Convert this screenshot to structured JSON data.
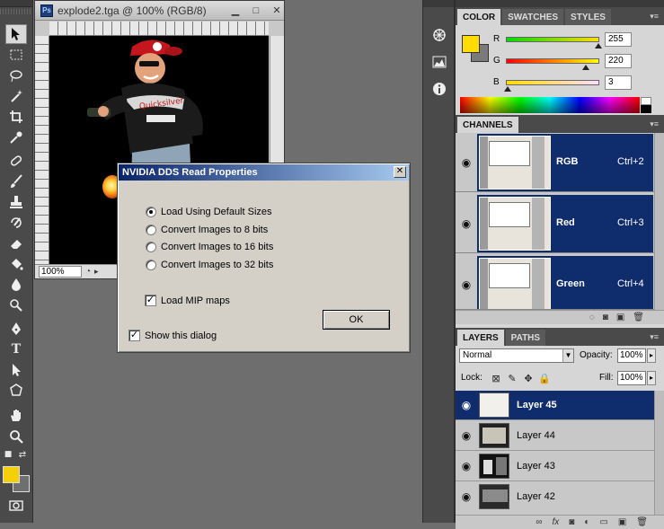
{
  "document": {
    "title": "explode2.tga @ 100% (RGB/8)",
    "ps_badge": "Ps",
    "zoom": "100%"
  },
  "dialog": {
    "title": "NVIDIA DDS Read Properties",
    "close": "✕",
    "options": [
      {
        "label": "Load Using Default Sizes",
        "selected": true
      },
      {
        "label": "Convert Images to 8 bits",
        "selected": false
      },
      {
        "label": "Convert Images to 16 bits",
        "selected": false
      },
      {
        "label": "Convert Images to 32 bits",
        "selected": false
      }
    ],
    "load_mip_maps": {
      "label": "Load MIP maps",
      "checked": true
    },
    "show_dialog": {
      "label": "Show this dialog",
      "checked": true
    },
    "ok_label": "OK"
  },
  "toolbox": {
    "foreground_color": "#f5cf0a",
    "background_color": "#6f6f6f"
  },
  "color_panel": {
    "tabs": [
      "COLOR",
      "SWATCHES",
      "STYLES"
    ],
    "sliders": [
      {
        "label": "R",
        "value": "255",
        "fraction": 1.0
      },
      {
        "label": "G",
        "value": "220",
        "fraction": 0.863
      },
      {
        "label": "B",
        "value": "3",
        "fraction": 0.012
      }
    ],
    "foreground_color": "#ffdc03"
  },
  "channels_panel": {
    "tabs": [
      "CHANNELS"
    ],
    "channels": [
      {
        "name": "RGB",
        "shortcut": "Ctrl+2"
      },
      {
        "name": "Red",
        "shortcut": "Ctrl+3"
      },
      {
        "name": "Green",
        "shortcut": "Ctrl+4"
      }
    ]
  },
  "layers_panel": {
    "tabs": [
      "LAYERS",
      "PATHS"
    ],
    "blend_mode": "Normal",
    "opacity_label": "Opacity:",
    "opacity": "100%",
    "lock_label": "Lock:",
    "fill_label": "Fill:",
    "fill": "100%",
    "layers": [
      {
        "name": "Layer 45",
        "selected": true
      },
      {
        "name": "Layer 44",
        "selected": false
      },
      {
        "name": "Layer 43",
        "selected": false
      },
      {
        "name": "Layer 42",
        "selected": false
      }
    ]
  },
  "colors": {
    "selection_blue": "#0f2d6c",
    "dialog_gray": "#d4d0c8",
    "title_gradient_start": "#0a246a"
  }
}
